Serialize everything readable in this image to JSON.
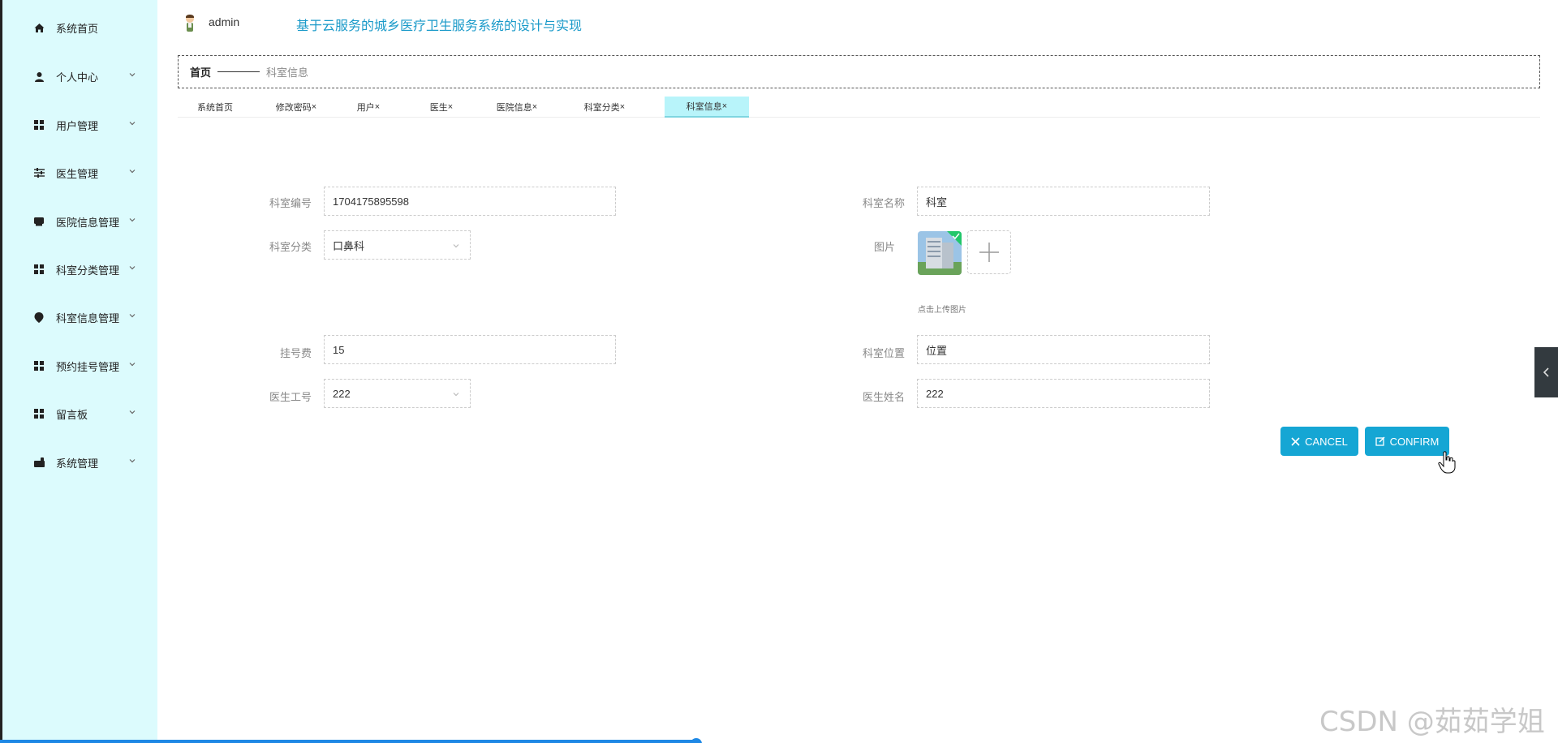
{
  "sidebar": {
    "items": [
      {
        "label": "系统首页",
        "icon": "home-icon",
        "has_arrow": false
      },
      {
        "label": "个人中心",
        "icon": "user-icon",
        "has_arrow": true
      },
      {
        "label": "用户管理",
        "icon": "grid-icon",
        "has_arrow": true
      },
      {
        "label": "医生管理",
        "icon": "sliders-icon",
        "has_arrow": true
      },
      {
        "label": "医院信息管理",
        "icon": "hospital-icon",
        "has_arrow": true
      },
      {
        "label": "科室分类管理",
        "icon": "grid-icon",
        "has_arrow": true
      },
      {
        "label": "科室信息管理",
        "icon": "location-icon",
        "has_arrow": true
      },
      {
        "label": "预约挂号管理",
        "icon": "grid-icon",
        "has_arrow": true
      },
      {
        "label": "留言板",
        "icon": "grid-icon",
        "has_arrow": true
      },
      {
        "label": "系统管理",
        "icon": "settings-icon",
        "has_arrow": true
      }
    ]
  },
  "header": {
    "username": "admin",
    "title": "基于云服务的城乡医疗卫生服务系统的设计与实现"
  },
  "breadcrumb": {
    "home": "首页",
    "current": "科室信息"
  },
  "tabs": [
    {
      "label": "系统首页",
      "closable": false,
      "active": false
    },
    {
      "label": "修改密码",
      "closable": true,
      "active": false
    },
    {
      "label": "用户",
      "closable": true,
      "active": false
    },
    {
      "label": "医生",
      "closable": true,
      "active": false
    },
    {
      "label": "医院信息",
      "closable": true,
      "active": false
    },
    {
      "label": "科室分类",
      "closable": true,
      "active": false
    },
    {
      "label": "科室信息",
      "closable": true,
      "active": true
    }
  ],
  "tab_close_glyph": "×",
  "form": {
    "dept_no": {
      "label": "科室编号",
      "value": "1704175895598"
    },
    "dept_name": {
      "label": "科室名称",
      "value": "科室"
    },
    "dept_category": {
      "label": "科室分类",
      "value": "口鼻科"
    },
    "picture": {
      "label": "图片",
      "hint": "点击上传图片"
    },
    "reg_fee": {
      "label": "挂号费",
      "value": "15"
    },
    "dept_location": {
      "label": "科室位置",
      "value": "位置"
    },
    "doctor_id": {
      "label": "医生工号",
      "value": "222"
    },
    "doctor_name": {
      "label": "医生姓名",
      "value": "222"
    }
  },
  "buttons": {
    "cancel": "CANCEL",
    "confirm": "CONFIRM"
  },
  "colors": {
    "sidebar_bg": "#dcfbfd",
    "accent": "#15a6d4",
    "title": "#1a9ac9",
    "active_tab": "#b8f4fa"
  },
  "watermark": "CSDN @茹茹学姐",
  "video_progress": 0.447
}
